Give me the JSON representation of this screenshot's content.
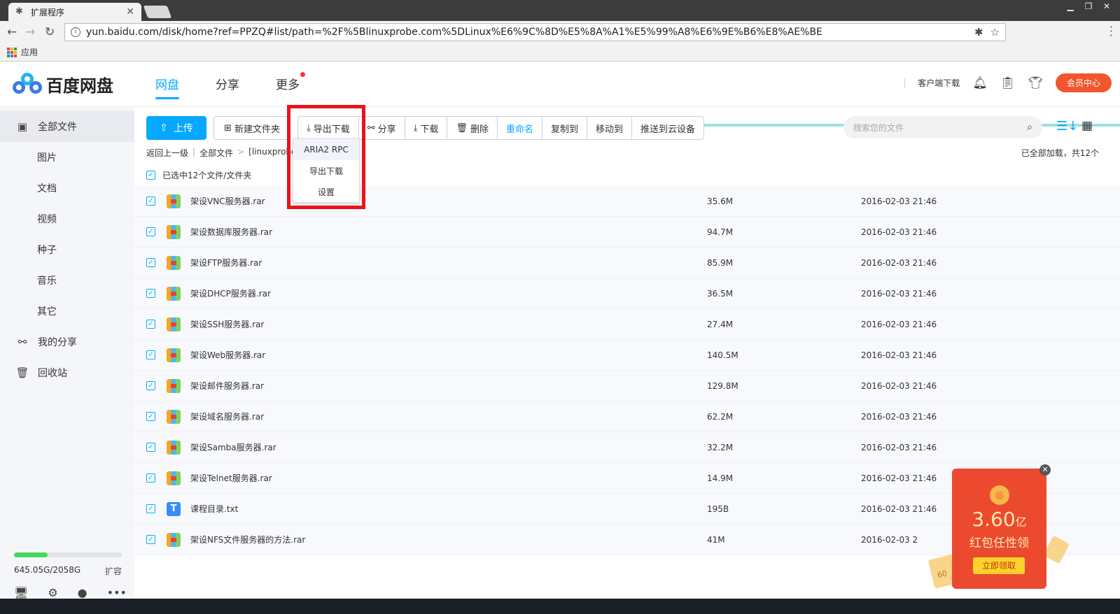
{
  "browser": {
    "tab_title": "扩展程序",
    "tab_close": "✕",
    "url": "yun.baidu.com/disk/home?ref=PPZQ#list/path=%2F%5Blinuxprobe.com%5DLinux%E6%9C%8D%E5%8A%A1%E5%99%A8%E6%9E%B6%E8%AE%BE",
    "bookmark_apps": "应用"
  },
  "header": {
    "logo_text": "百度网盘",
    "nav": [
      {
        "label": "网盘"
      },
      {
        "label": "分享"
      },
      {
        "label": "更多"
      }
    ],
    "client_download": "客户端下载",
    "vip": "会员中心"
  },
  "sidebar": {
    "items": [
      {
        "label": "全部文件",
        "icon": "folder-icon"
      },
      {
        "label": "图片"
      },
      {
        "label": "文档"
      },
      {
        "label": "视频"
      },
      {
        "label": "种子"
      },
      {
        "label": "音乐"
      },
      {
        "label": "其它"
      },
      {
        "label": "我的分享",
        "icon": "share-icon"
      },
      {
        "label": "回收站",
        "icon": "trash-icon"
      }
    ],
    "quota_text": "645.05G/2058G",
    "quota_fraction": 0.313,
    "expand": "扩容"
  },
  "toolbar": {
    "upload": "上传",
    "new_folder": "新建文件夹",
    "export_download": "导出下载",
    "share": "分享",
    "download": "下载",
    "delete": "删除",
    "rename": "重命名",
    "copy_to": "复制到",
    "move_to": "移动到",
    "push_cloud": "推送到云设备",
    "search_placeholder": "搜索您的文件"
  },
  "breadcrumb": {
    "back": "返回上一级",
    "all": "全部文件",
    "current": "[linuxprobe.co"
  },
  "loaded_text": "已全部加载，共12个",
  "select_all_text": "已选中12个文件/文件夹",
  "dropdown": [
    "ARIA2 RPC",
    "导出下载",
    "设置"
  ],
  "files": [
    {
      "name": "架设VNC服务器.rar",
      "size": "35.6M",
      "date": "2016-02-03 21:46",
      "type": "rar"
    },
    {
      "name": "架设数据库服务器.rar",
      "size": "94.7M",
      "date": "2016-02-03 21:46",
      "type": "rar"
    },
    {
      "name": "架设FTP服务器.rar",
      "size": "85.9M",
      "date": "2016-02-03 21:46",
      "type": "rar"
    },
    {
      "name": "架设DHCP服务器.rar",
      "size": "36.5M",
      "date": "2016-02-03 21:46",
      "type": "rar"
    },
    {
      "name": "架设SSH服务器.rar",
      "size": "27.4M",
      "date": "2016-02-03 21:46",
      "type": "rar"
    },
    {
      "name": "架设Web服务器.rar",
      "size": "140.5M",
      "date": "2016-02-03 21:46",
      "type": "rar"
    },
    {
      "name": "架设邮件服务器.rar",
      "size": "129.8M",
      "date": "2016-02-03 21:46",
      "type": "rar"
    },
    {
      "name": "架设域名服务器.rar",
      "size": "62.2M",
      "date": "2016-02-03 21:46",
      "type": "rar"
    },
    {
      "name": "架设Samba服务器.rar",
      "size": "32.2M",
      "date": "2016-02-03 21:46",
      "type": "rar"
    },
    {
      "name": "架设Telnet服务器.rar",
      "size": "14.9M",
      "date": "2016-02-03 21:46",
      "type": "rar"
    },
    {
      "name": "课程目录.txt",
      "size": "195B",
      "date": "2016-02-03 21:46",
      "type": "txt"
    },
    {
      "name": "架设NFS文件服务器的方法.rar",
      "size": "41M",
      "date": "2016-02-03 2",
      "type": "rar"
    }
  ],
  "promo": {
    "amount": "3.60",
    "unit": "亿",
    "subtitle": "红包任性领",
    "button": "立即领取",
    "ticket": "60"
  },
  "colors": {
    "accent": "#06a7ff",
    "vip": "#f2562d",
    "highlight": "#e8141c",
    "quota": "#44d85e"
  }
}
